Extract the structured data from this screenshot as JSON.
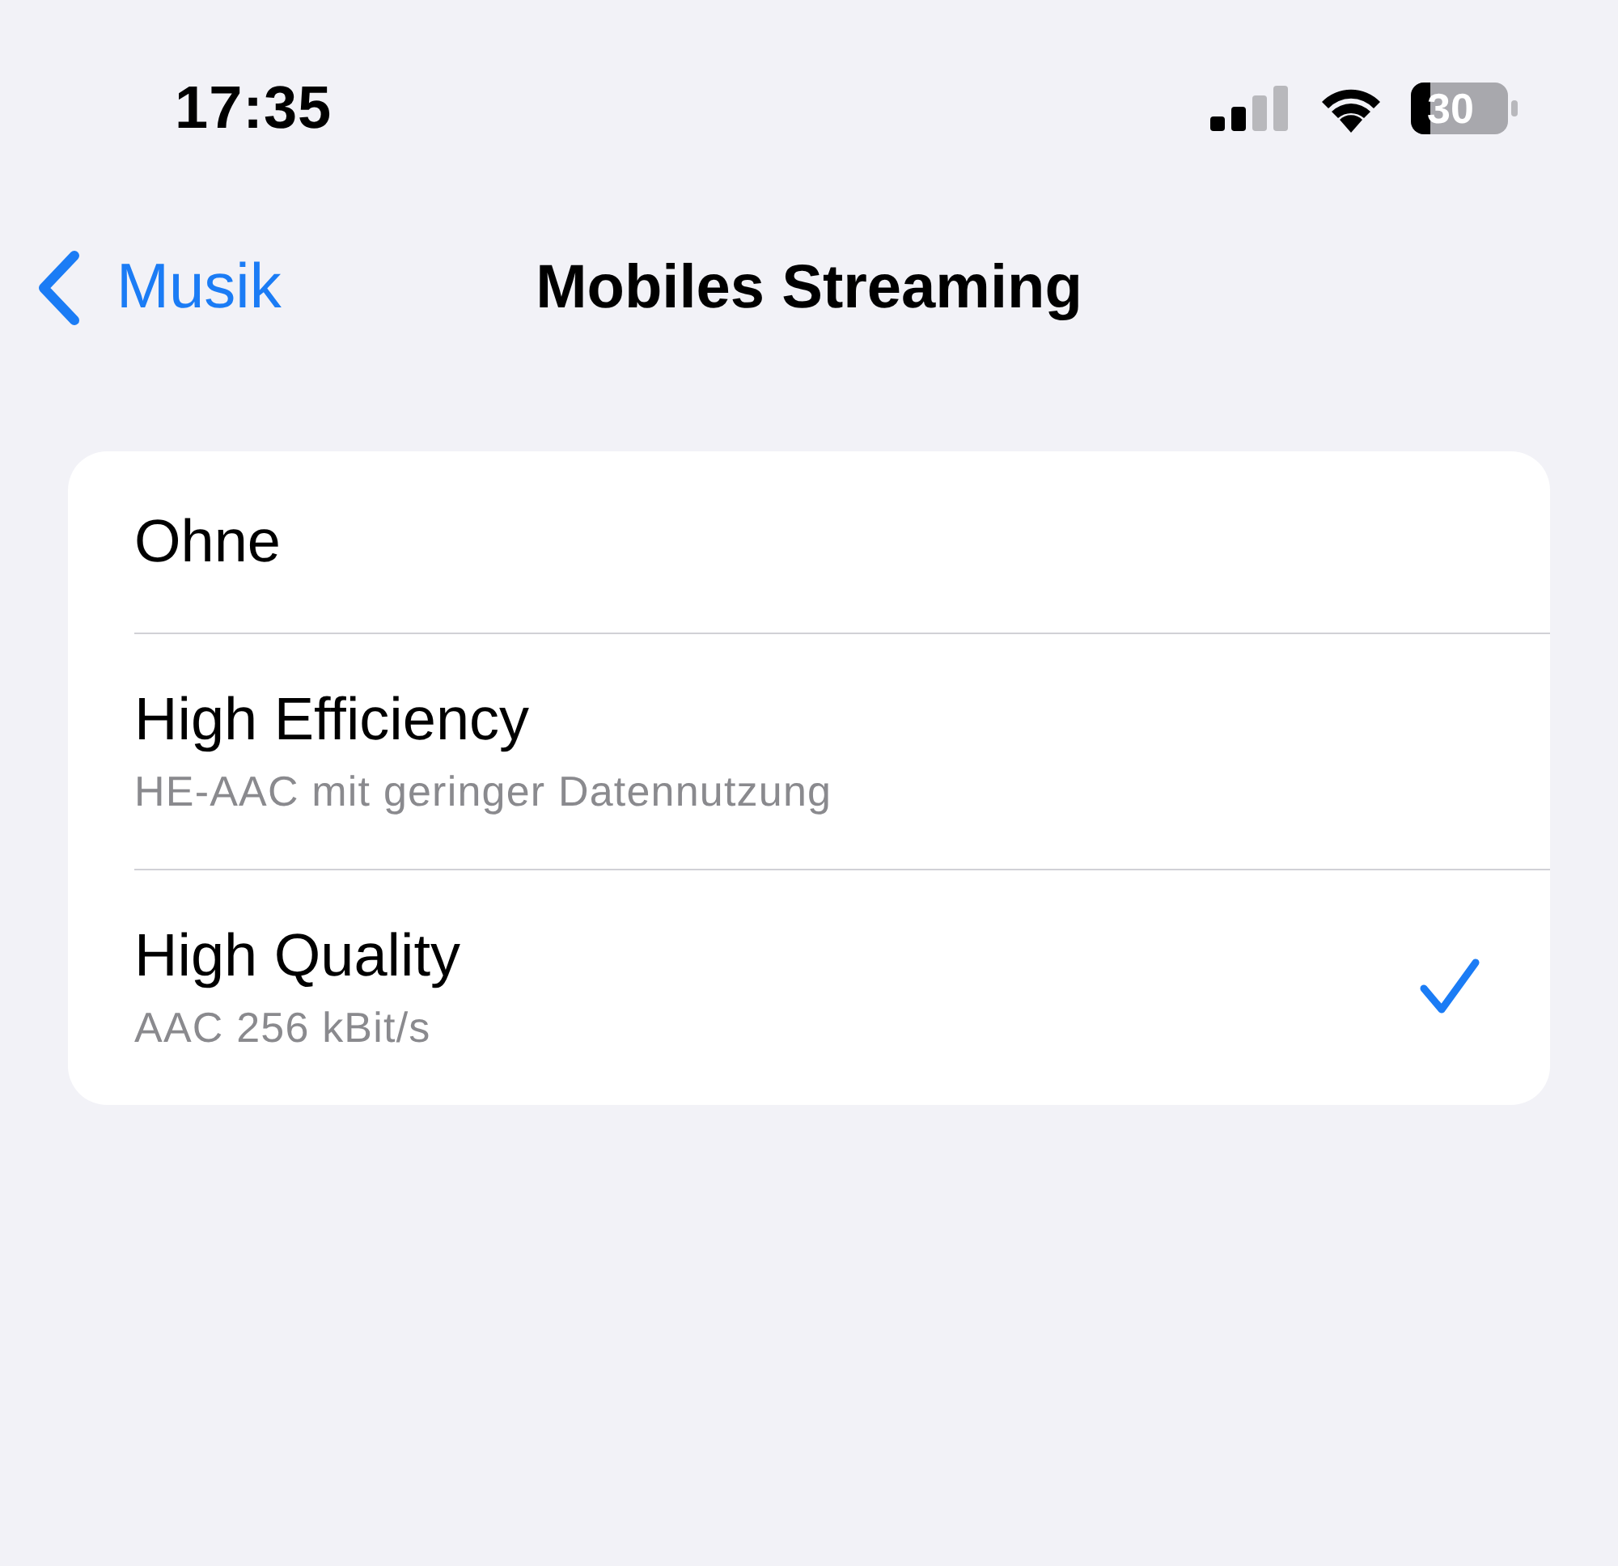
{
  "status_bar": {
    "time": "17:35",
    "battery": "30"
  },
  "nav": {
    "back": "Musik",
    "title": "Mobiles Streaming"
  },
  "options": [
    {
      "label": "Ohne",
      "selected": false
    },
    {
      "label": "High Efficiency",
      "detail": "HE-AAC mit geringer Datennutzung",
      "selected": false
    },
    {
      "label": "High Quality",
      "detail": "AAC 256 kBit/s",
      "selected": true
    }
  ]
}
